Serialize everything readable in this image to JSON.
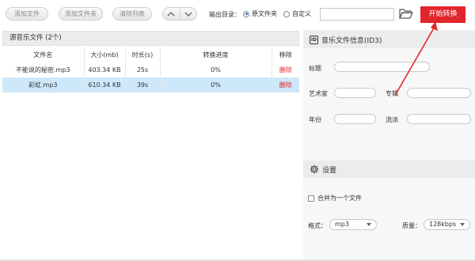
{
  "toolbar": {
    "add_file": "添加文件",
    "add_folder": "添加文件夹",
    "clear_list": "清除列表",
    "output_dir_label": "输出目录：",
    "radio_original": "原文件夹",
    "radio_custom": "自定义",
    "path_value": "",
    "start_button": "开始转换"
  },
  "file_list": {
    "header": "源音乐文件 (2个)",
    "columns": [
      "文件名",
      "大小(mb)",
      "时长(s)",
      "转换进度",
      "移除"
    ],
    "rows": [
      {
        "name": "不能说的秘密.mp3",
        "size": "403.34 KB",
        "duration": "25s",
        "progress": "0%",
        "remove": "删除"
      },
      {
        "name": "彩虹.mp3",
        "size": "610.34 KB",
        "duration": "39s",
        "progress": "0%",
        "remove": "删除"
      }
    ]
  },
  "id3": {
    "icon_text": "ID",
    "title": "音乐文件信息(ID3)",
    "title_label": "标题",
    "artist_label": "艺术家",
    "album_label": "专辑",
    "year_label": "年份",
    "genre_label": "流派"
  },
  "settings": {
    "title": "设置",
    "merge_label": "合并为一个文件",
    "format_label": "格式：",
    "format_value": "mp3",
    "quality_label": "质量：",
    "quality_value": "128kbps"
  },
  "colors": {
    "accent_red": "#e0262b",
    "selected_row": "#cde8fa"
  }
}
